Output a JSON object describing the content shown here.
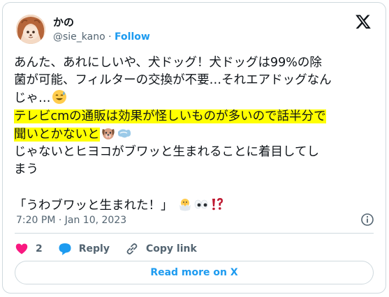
{
  "author": {
    "name": "かの",
    "handle": "@sie_kano",
    "separator": "·",
    "follow_label": "Follow"
  },
  "tweet": {
    "lines": [
      "あんた、あれにしいや、犬ドッグ！犬ドッグは99%の除",
      "菌が可能、フィルターの交換が不要…それエアドッグなん",
      "じゃ…",
      "テレビcmの通販は効果が怪しいものが多いので話半分で",
      "聞いとかないと",
      "じゃないとヒヨコがブワッと生まれることに着目してし",
      "まう",
      "「うわブワッと生まれた！」"
    ],
    "emojis": {
      "line3": [
        "sweat-smile-emoji"
      ],
      "line5": [
        "dog-face-emoji",
        "dash-emoji"
      ],
      "line8": [
        "hatching-chick-emoji",
        "eyes-emoji",
        "exclamation-question-emoji"
      ]
    },
    "highlight_color": "#ffff00"
  },
  "meta": {
    "timestamp": "7:20 PM · Jan 10, 2023"
  },
  "actions": {
    "like_count": "2",
    "reply_label": "Reply",
    "copy_link_label": "Copy link"
  },
  "read_more_label": "Read more on X",
  "colors": {
    "accent": "#1d9bf0",
    "like": "#f91880",
    "secondary_text": "#536471",
    "border": "#cfd9de"
  }
}
